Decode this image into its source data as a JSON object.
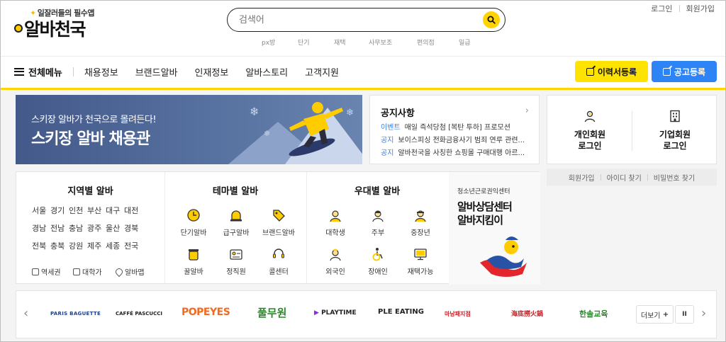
{
  "header": {
    "tagline": "일잘러들의 필수앱",
    "logo_text": "알바천국",
    "search": {
      "placeholder": "검색어",
      "value": ""
    },
    "keywords": [
      "px방",
      "단기",
      "재택",
      "사무보조",
      "편의점",
      "일급"
    ],
    "top_links": [
      "로그인",
      "회원가입"
    ]
  },
  "nav": {
    "all_menu": "전체메뉴",
    "items": [
      "채용정보",
      "브랜드알바",
      "인재정보",
      "알바스토리",
      "고객지원"
    ],
    "resume_button": "이력서등록",
    "post_button": "공고등록"
  },
  "banner": {
    "line1": "스키장 알바가 천국으로 몰려든다!",
    "line2": "스키장 알바 채용관"
  },
  "notice": {
    "title": "공지사항",
    "rows": [
      {
        "tag": "이벤트",
        "text": "매일 즉석당첨 [복탄 투하] 프로모션"
      },
      {
        "tag": "공지",
        "text": "보이스피싱 전화금융사기 범죄 연루 관련..."
      },
      {
        "tag": "공지",
        "text": "알바천국을 사칭한 쇼핑몰 구매대행 아르..."
      }
    ]
  },
  "login": {
    "personal": [
      "개인회원",
      "로그인"
    ],
    "company": [
      "기업회원",
      "로그인"
    ],
    "links": [
      "회원가입",
      "아이디 찾기",
      "비밀번호 찾기"
    ]
  },
  "categories": {
    "region": {
      "title": "지역별 알바",
      "rows": [
        [
          "서울",
          "경기",
          "인천",
          "부산",
          "대구",
          "대전"
        ],
        [
          "경남",
          "전남",
          "충남",
          "광주",
          "울산",
          "경북"
        ],
        [
          "전북",
          "충북",
          "강원",
          "제주",
          "세종",
          "전국"
        ]
      ],
      "links": [
        "역세권",
        "대학가",
        "알바맵"
      ]
    },
    "theme": {
      "title": "테마별 알바",
      "items": [
        "단기알바",
        "급구알바",
        "브랜드알바",
        "꿀알바",
        "정직원",
        "콜센터"
      ]
    },
    "preferred": {
      "title": "우대별 알바",
      "items": [
        "대학생",
        "주부",
        "중장년",
        "외국인",
        "장애인",
        "재택가능"
      ]
    },
    "counsel": {
      "subtitle": "청소년근로권익센터",
      "title_line1": "알바상담센터",
      "title_line2": "알바지킴이"
    }
  },
  "brands": {
    "logos": [
      "PARIS BAGUETTE",
      "CAFFÉ PASCUCCI",
      "POPEYES",
      "풀무원",
      "PLAYTIME",
      "PLE EATING",
      "마남패지점",
      "海底撈火鍋",
      "한솔교육"
    ],
    "more_label": "더보기",
    "pause_label": "II"
  },
  "colors": {
    "accent_yellow": "#ffd400",
    "primary_blue": "#2e84f5"
  }
}
